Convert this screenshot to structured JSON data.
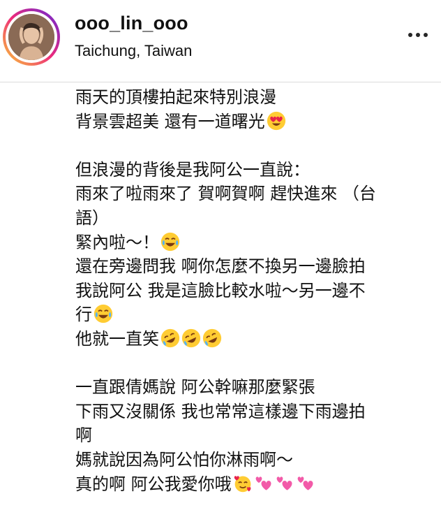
{
  "post": {
    "username": "ooo_lin_ooo",
    "location": "Taichung, Taiwan",
    "more_icon": "more-horizontal-icon",
    "avatar": "profile-photo"
  },
  "caption": {
    "lines": [
      {
        "text": "雨天的頂樓拍起來特別浪漫",
        "emoji": []
      },
      {
        "text": "背景雲超美 還有一道曙光",
        "emoji": [
          "heart-eyes"
        ]
      },
      {
        "text": "",
        "emoji": []
      },
      {
        "text": "但浪漫的背後是我阿公一直說：",
        "emoji": []
      },
      {
        "text": "雨來了啦雨來了 賀啊賀啊 趕快進來 （台",
        "emoji": []
      },
      {
        "text": "語）",
        "emoji": []
      },
      {
        "text": "緊內啦～！",
        "emoji": [
          "tears-of-joy"
        ]
      },
      {
        "text": "還在旁邊問我 啊你怎麼不換另一邊臉拍",
        "emoji": []
      },
      {
        "text": "我說阿公 我是這臉比較水啦～另一邊不",
        "emoji": []
      },
      {
        "text": "行",
        "emoji": [
          "tears-of-joy"
        ]
      },
      {
        "text": "他就一直笑",
        "emoji": [
          "rofl",
          "rofl",
          "rofl"
        ]
      },
      {
        "text": "",
        "emoji": []
      },
      {
        "text": "一直跟倩媽說 阿公幹嘛那麼緊張",
        "emoji": []
      },
      {
        "text": "下雨又沒關係 我也常常這樣邊下雨邊拍",
        "emoji": []
      },
      {
        "text": "啊",
        "emoji": []
      },
      {
        "text": "媽就說因為阿公怕你淋雨啊～",
        "emoji": []
      },
      {
        "text": "真的啊 阿公我愛你哦",
        "emoji": [
          "smiling-hearts",
          "two-hearts",
          "two-hearts",
          "two-hearts"
        ]
      }
    ]
  }
}
